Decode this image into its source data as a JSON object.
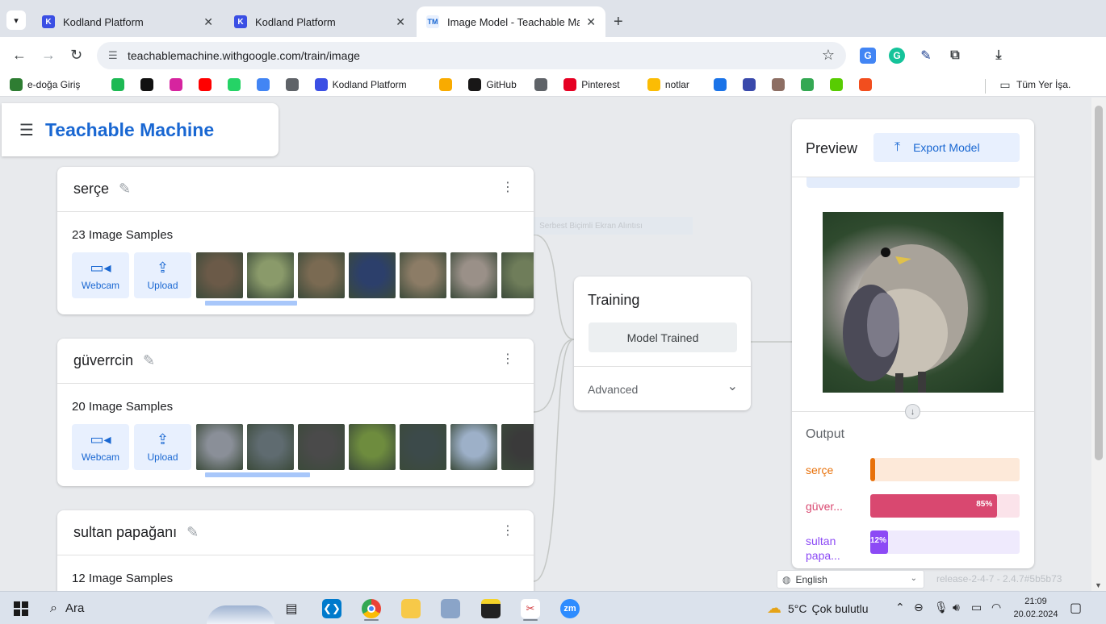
{
  "browser": {
    "tabs": [
      {
        "title": "Kodland Platform",
        "active": false,
        "icon": "kodland-icon"
      },
      {
        "title": "Kodland Platform",
        "active": false,
        "icon": "kodland-icon"
      },
      {
        "title": "Image Model - Teachable Machi",
        "active": true,
        "icon": "teachable-machine-icon"
      }
    ],
    "new_tab": "+",
    "url": "teachablemachine.withgoogle.com/train/image",
    "bookmarks": [
      {
        "label": "e-doğa Giriş",
        "color": "#2e7d32",
        "icon": "edoga-icon"
      },
      {
        "label": "",
        "color": "#1db954",
        "icon": "spotify-icon"
      },
      {
        "label": "",
        "color": "#111111",
        "icon": "hackerrank-icon"
      },
      {
        "label": "",
        "color": "#d6249f",
        "icon": "instagram-icon"
      },
      {
        "label": "",
        "color": "#ff0000",
        "icon": "youtube-icon"
      },
      {
        "label": "",
        "color": "#25d366",
        "icon": "whatsapp-icon"
      },
      {
        "label": "",
        "color": "#4285f4",
        "icon": "gmeet-icon"
      },
      {
        "label": "",
        "color": "#5f6368",
        "icon": "monitor-icon"
      },
      {
        "label": "Kodland Platform",
        "color": "#3b4fe4",
        "icon": "kodland-icon"
      },
      {
        "label": "",
        "color": "#f9ab00",
        "icon": "colab-icon"
      },
      {
        "label": "GitHub",
        "color": "#181717",
        "icon": "github-icon"
      },
      {
        "label": "",
        "color": "#5f6368",
        "icon": "swirl-icon"
      },
      {
        "label": "Pinterest",
        "color": "#e60023",
        "icon": "pinterest-icon"
      },
      {
        "label": "notlar",
        "color": "#fbbc04",
        "icon": "keep-icon"
      },
      {
        "label": "",
        "color": "#1a73e8",
        "icon": "grid-app-icon"
      },
      {
        "label": "",
        "color": "#3949ab",
        "icon": "computer-icon"
      },
      {
        "label": "",
        "color": "#8d6e63",
        "icon": "box-icon"
      },
      {
        "label": "",
        "color": "#34a853",
        "icon": "sprout-icon"
      },
      {
        "label": "",
        "color": "#58cc02",
        "icon": "duolingo-icon"
      },
      {
        "label": "",
        "color": "#f24e1e",
        "icon": "figma-icon"
      }
    ],
    "all_bookmarks": "Tüm Yer İşa."
  },
  "app": {
    "brand": "Teachable Machine",
    "ghost_label": "Serbest Biçimli Ekran Alıntısı",
    "classes": [
      {
        "name": "serçe",
        "samples": "23 Image Samples",
        "webcam": "Webcam",
        "upload": "Upload",
        "thumb_colors": [
          "#6b5a48",
          "#8a9a6a",
          "#7a6a52",
          "#2c3f6b",
          "#8c7c66",
          "#9a9088",
          "#6f7d5a"
        ]
      },
      {
        "name": "güverrcin",
        "samples": "20 Image Samples",
        "webcam": "Webcam",
        "upload": "Upload",
        "thumb_colors": [
          "#8a8f98",
          "#5f6b70",
          "#4a4a4a",
          "#6e8c3e",
          "#3c4a4a",
          "#9db0c8",
          "#3a3a3a"
        ]
      },
      {
        "name": "sultan papağanı",
        "samples": "12 Image Samples"
      }
    ],
    "training": {
      "title": "Training",
      "button": "Model Trained",
      "advanced": "Advanced"
    },
    "preview": {
      "title": "Preview",
      "export": "Export Model",
      "output_title": "Output",
      "outputs": [
        {
          "label": "serçe",
          "percent": 2,
          "pct_text": "",
          "color": "#e8710a",
          "track": "#fde9d9"
        },
        {
          "label": "güver...",
          "percent": 85,
          "pct_text": "85%",
          "color": "#d94870",
          "track": "#fbe3ea"
        },
        {
          "label": "sultan papa...",
          "percent": 12,
          "pct_text": "12%",
          "color": "#8c4af5",
          "track": "#efeafd"
        }
      ]
    },
    "language": "English",
    "release": "release-2-4-7 - 2.4.7#5b5b73"
  },
  "taskbar": {
    "search": "Ara",
    "weather_temp": "5°C",
    "weather_text": "Çok bulutlu",
    "time": "21:09",
    "date": "20.02.2024"
  }
}
